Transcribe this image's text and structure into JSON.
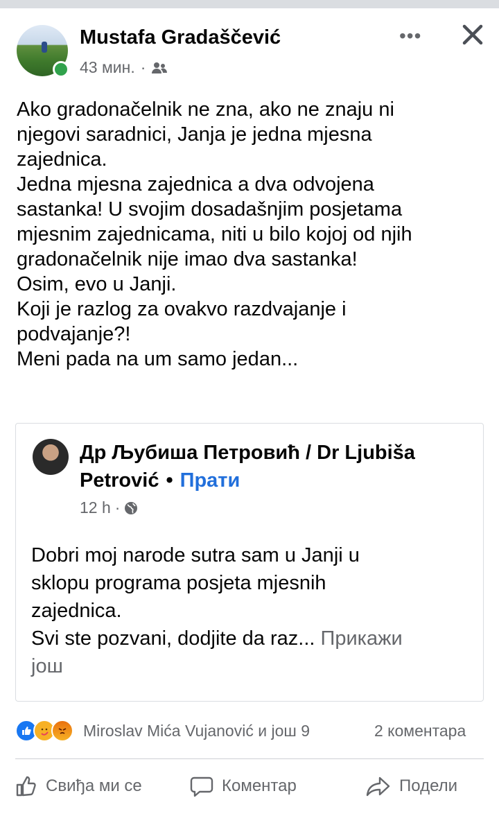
{
  "post": {
    "author": "Mustafa Gradaščević",
    "time": "43 мин.",
    "separator": "·",
    "audience_icon": "friends-icon",
    "lines": [
      "Ako gradonačelnik ne zna, ako ne znaju ni",
      "njegovi saradnici, Janja je jedna mjesna",
      "zajednica.",
      "Jedna mjesna zajednica a dva odvojena",
      "sastanka! U svojim dosadašnjim posjetama",
      "mjesnim zajednicama, niti u bilo kojoj od njih",
      "gradonačelnik nije imao dva sastanka!",
      "Osim, evo u Janji.",
      "Koji je razlog za ovakvo razdvajanje i",
      "podvajanje?!",
      "Meni pada na um samo jedan..."
    ]
  },
  "shared": {
    "author_line1": "Др Љубиша Петровић / Dr Ljubiša",
    "author_line2": "Petrović",
    "dot": "•",
    "follow": "Прати",
    "time": "12 h",
    "separator": "·",
    "audience_icon": "globe-icon",
    "lines": [
      "Dobri moj narode sutra sam u Janji u",
      "sklopu programa posjeta mjesnih",
      "zajednica."
    ],
    "last_line": "Svi ste pozvani, dodjite da raz...",
    "see_more_1": "Прикажи",
    "see_more_2": "још"
  },
  "reactions": {
    "names": "Miroslav Mića Vujanović и још 9",
    "comments": "2 коментара"
  },
  "actions": {
    "like": "Свиђа ми се",
    "comment": "Коментар",
    "share": "Подели"
  },
  "colors": {
    "accent": "#216fdb",
    "secondary_text": "#65676b",
    "online": "#31a24c"
  }
}
